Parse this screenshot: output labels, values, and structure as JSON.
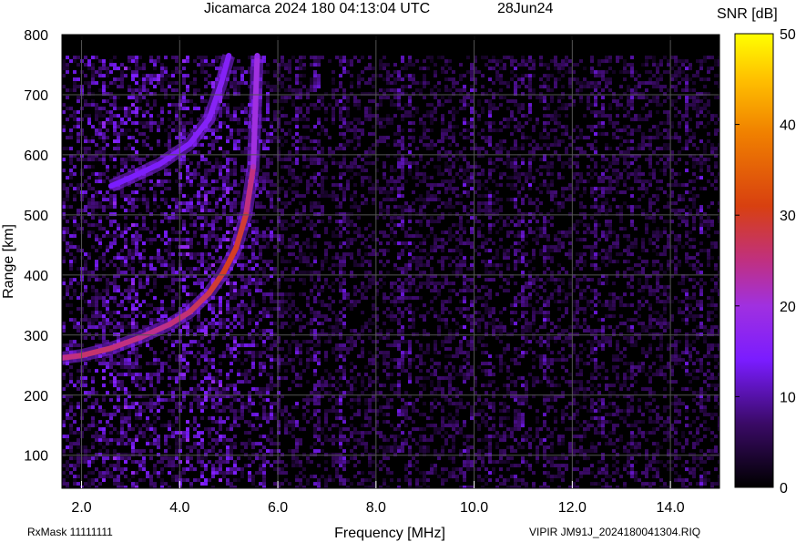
{
  "chart_data": {
    "type": "heatmap",
    "title": "Jicamarca 2024 180 04:13:04 UTC",
    "date": "28Jun24",
    "xlabel": "Frequency [MHz]",
    "ylabel": "Range [km]",
    "xlim": [
      1.6,
      15.0
    ],
    "ylim": [
      45,
      800
    ],
    "x_ticks": [
      "2.0",
      "4.0",
      "6.0",
      "8.0",
      "10.0",
      "12.0",
      "14.0"
    ],
    "x_tick_values": [
      2.0,
      4.0,
      6.0,
      8.0,
      10.0,
      12.0,
      14.0
    ],
    "y_ticks": [
      "100",
      "200",
      "300",
      "400",
      "500",
      "600",
      "700",
      "800"
    ],
    "y_tick_values": [
      100,
      200,
      300,
      400,
      500,
      600,
      700,
      800
    ],
    "colorbar": {
      "label": "SNR [dB]",
      "range": [
        0,
        50
      ],
      "ticks": [
        "0",
        "10",
        "20",
        "30",
        "40",
        "50"
      ],
      "tick_values": [
        0,
        10,
        20,
        30,
        40,
        50
      ]
    },
    "grid": true,
    "traces": [
      {
        "name": "",
        "freq_mhz": [
          1.6,
          2.0,
          2.6,
          3.2,
          3.8,
          4.2,
          4.6,
          4.9,
          5.15,
          5.35,
          5.5,
          5.58
        ],
        "range_km": [
          262,
          266,
          278,
          296,
          318,
          338,
          370,
          405,
          445,
          500,
          580,
          765
        ],
        "snr_db": [
          24,
          26,
          26,
          24,
          25,
          26,
          28,
          30,
          30,
          28,
          22,
          18
        ]
      },
      {
        "name": "",
        "freq_mhz": [
          2.6,
          3.0,
          3.6,
          4.2,
          4.6,
          4.85,
          5.0
        ],
        "range_km": [
          548,
          562,
          585,
          618,
          660,
          720,
          765
        ],
        "snr_db": [
          14,
          14,
          15,
          15,
          16,
          16,
          15
        ]
      }
    ]
  },
  "footer": {
    "left": "RxMask 11111111",
    "right": "VIPIR  JM91J_2024180041304.RIQ"
  }
}
